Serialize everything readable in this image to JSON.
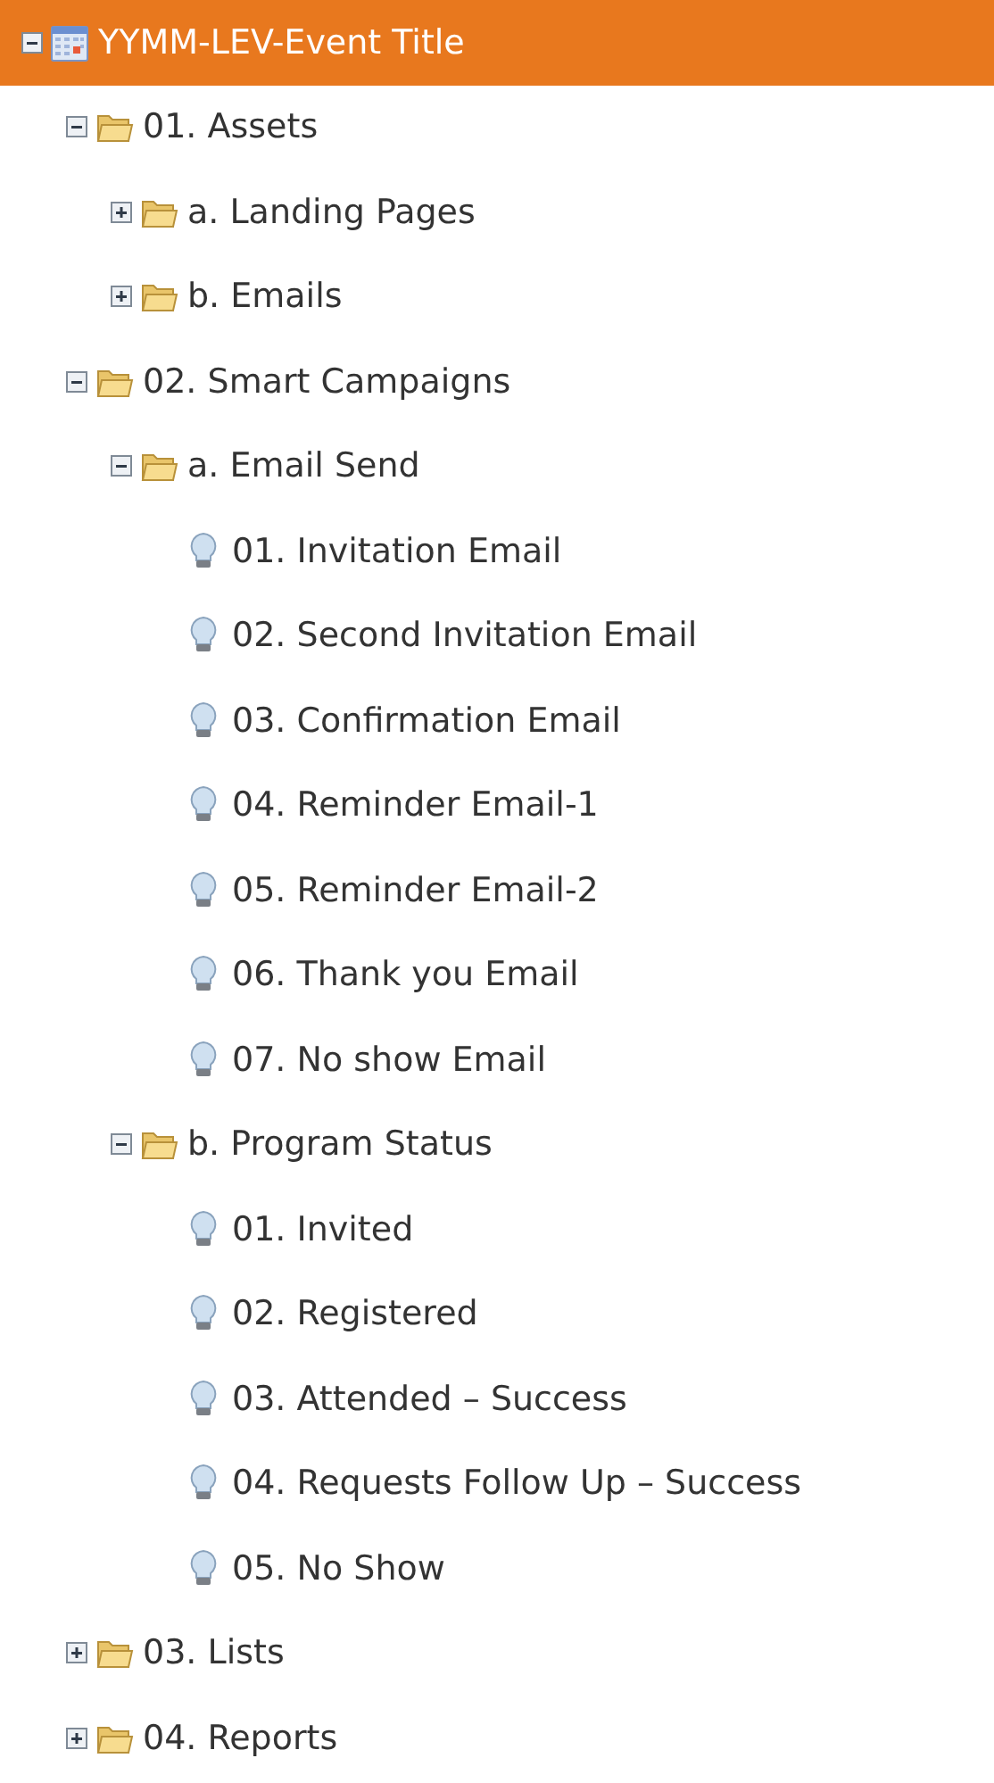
{
  "tree": [
    {
      "label": "YYMM-LEV-Event Title",
      "kind": "program",
      "expanded": true,
      "selected": true,
      "children": [
        {
          "label": "01. Assets",
          "kind": "folder",
          "expanded": true,
          "selected": false,
          "children": [
            {
              "label": "a. Landing Pages",
              "kind": "folder",
              "expanded": false,
              "selected": false
            },
            {
              "label": "b. Emails",
              "kind": "folder",
              "expanded": false,
              "selected": false
            }
          ]
        },
        {
          "label": "02. Smart Campaigns",
          "kind": "folder",
          "expanded": true,
          "selected": false,
          "children": [
            {
              "label": "a. Email Send",
              "kind": "folder",
              "expanded": true,
              "selected": false,
              "children": [
                {
                  "label": "01. Invitation Email",
                  "kind": "campaign",
                  "selected": false
                },
                {
                  "label": "02. Second Invitation Email",
                  "kind": "campaign",
                  "selected": false
                },
                {
                  "label": "03. Confirmation Email",
                  "kind": "campaign",
                  "selected": false
                },
                {
                  "label": "04. Reminder Email-1",
                  "kind": "campaign",
                  "selected": false
                },
                {
                  "label": "05. Reminder Email-2",
                  "kind": "campaign",
                  "selected": false
                },
                {
                  "label": "06. Thank you Email",
                  "kind": "campaign",
                  "selected": false
                },
                {
                  "label": "07. No show Email",
                  "kind": "campaign",
                  "selected": false
                }
              ]
            },
            {
              "label": "b. Program Status",
              "kind": "folder",
              "expanded": true,
              "selected": false,
              "children": [
                {
                  "label": "01. Invited",
                  "kind": "campaign",
                  "selected": false
                },
                {
                  "label": "02. Registered",
                  "kind": "campaign",
                  "selected": false
                },
                {
                  "label": "03. Attended – Success",
                  "kind": "campaign",
                  "selected": false
                },
                {
                  "label": "04. Requests Follow Up – Success",
                  "kind": "campaign",
                  "selected": false
                },
                {
                  "label": "05. No Show",
                  "kind": "campaign",
                  "selected": false
                }
              ]
            }
          ]
        },
        {
          "label": "03. Lists",
          "kind": "folder",
          "expanded": false,
          "selected": false
        },
        {
          "label": "04. Reports",
          "kind": "folder",
          "expanded": false,
          "selected": false
        }
      ]
    }
  ]
}
